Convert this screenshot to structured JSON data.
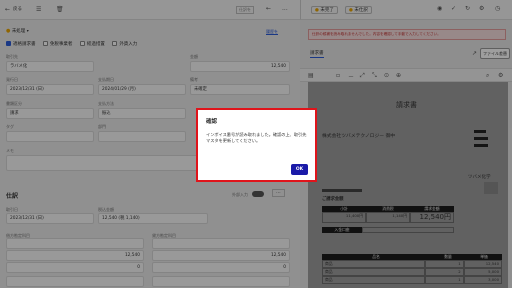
{
  "topbar": {
    "back_label": "戻る",
    "status_label": "仕訳を",
    "more": "..."
  },
  "form": {
    "status": "未処理",
    "edit_history": "履歴を",
    "checkboxes": [
      {
        "label": "適格請求書",
        "checked": true
      },
      {
        "label": "免税事業者",
        "checked": false
      },
      {
        "label": "経過措置",
        "checked": false
      },
      {
        "label": "外貨入力",
        "checked": false
      }
    ],
    "labels": {
      "partner": "取引先",
      "amount": "金額",
      "issue_date": "発行日",
      "due_date": "支払期日",
      "memo_label": "備考",
      "document_type": "書類区分",
      "payment_method": "支払方法",
      "note": "メモ",
      "invoice_no": "登録番号",
      "tag": "タグ",
      "department": "部門",
      "date": "取引日",
      "tax_amount": "税込金額"
    },
    "partner": "ラバメ化",
    "amount": "12,540",
    "issue_date": "2023/12/31 (日)",
    "due_date": "2024/01/29 (月)",
    "memo": "未確定",
    "document_type": "請求",
    "payment_method": "振込",
    "note": ""
  },
  "journal": {
    "title": "仕訳",
    "auto_input": "外部入力",
    "date": "2023/12/31 (日)",
    "tax_included": "12,540 (税 1,140)",
    "debit_label": "借方勘定科目",
    "credit_label": "貸方勘定科目",
    "rows": [
      {
        "debit": "",
        "credit": ""
      },
      {
        "debit": "12,540",
        "credit": "12,540"
      },
      {
        "debit": "0",
        "credit": "0"
      },
      {
        "debit": "",
        "credit": ""
      }
    ]
  },
  "right": {
    "tabs": [
      "未完了",
      "未仕訳"
    ],
    "notice": "仕訳の候補を読み取れませんでした。内容を確認して手動で入力してください。",
    "doc_tab": "請求書",
    "upload_button": "ファイル差替",
    "zoom": "100%"
  },
  "document": {
    "title": "請求書",
    "recipient": "株式会社ツバメテクノロジー 御中",
    "issuer": "ツバメ化学",
    "total_label": "ご請求金額",
    "total": "12,540円",
    "table_headers": [
      "小計",
      "消費税",
      "請求金額"
    ],
    "table_values": [
      "11,400円",
      "1,140円",
      "12,540円"
    ],
    "item_headers": [
      "品名",
      "数量",
      "単価"
    ],
    "items": [
      [
        "商品",
        "1",
        "12,540"
      ],
      [
        "商品",
        "2",
        "5,000"
      ],
      [
        "商品",
        "1",
        "3,000"
      ]
    ]
  },
  "dialog": {
    "title": "確認",
    "message": "インボイス番号が読み取れました。確認の上、取引先マスタを更新してください。",
    "ok": "OK"
  },
  "colors": {
    "dialog_border": "#e0141b",
    "ok_button": "#1a1aa8",
    "accent": "#2b5bd7"
  }
}
